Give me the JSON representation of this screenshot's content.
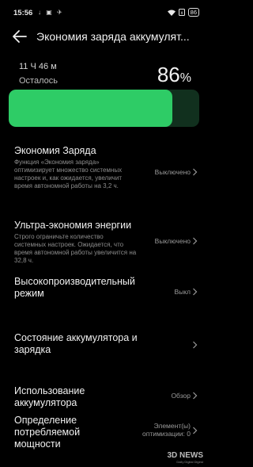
{
  "status_bar": {
    "time": "15:56",
    "left_icons": "↓ ▣ ✈",
    "right_icons": "wifi ▣",
    "battery": "86"
  },
  "header": {
    "title": "Экономия заряда аккумулят..."
  },
  "summary": {
    "time_left": "11 Ч 46 м",
    "remaining_label": "Осталось",
    "percent_value": "86",
    "percent_sign": "%",
    "level_fraction": 0.86,
    "bar_colors": {
      "fill": "#2ecc66",
      "track": "#11301e"
    }
  },
  "items": [
    {
      "title": "Экономия Заряда",
      "desc": "Функция «Экономия заряда» оптимизирует множество системных настроек и, как ожидается, увеличит время автономной работы на 3,2 ч.",
      "value": "Выключено"
    },
    {
      "title": "Ультра-экономия энергии",
      "desc": "Строго ограничьте количество системных настроек. Ожидается, что время автономной работы увеличится на 32,8 ч.",
      "value": "Выключено"
    },
    {
      "title": "Высокопроизводительный режим",
      "value": "Выкл"
    },
    {
      "title": "Состояние аккумулятора и зарядка"
    },
    {
      "title": "Использование аккумулятора",
      "value": "Обзор"
    },
    {
      "title": "Определение потребляемой мощности",
      "value": "Элемент(ы) оптимизации: 0"
    }
  ],
  "watermark": {
    "main": "3D NEWS",
    "sub": "Daily Digital Digest"
  },
  "icons": {
    "back": "back-arrow-icon",
    "chevron": "chevron-right-icon"
  }
}
